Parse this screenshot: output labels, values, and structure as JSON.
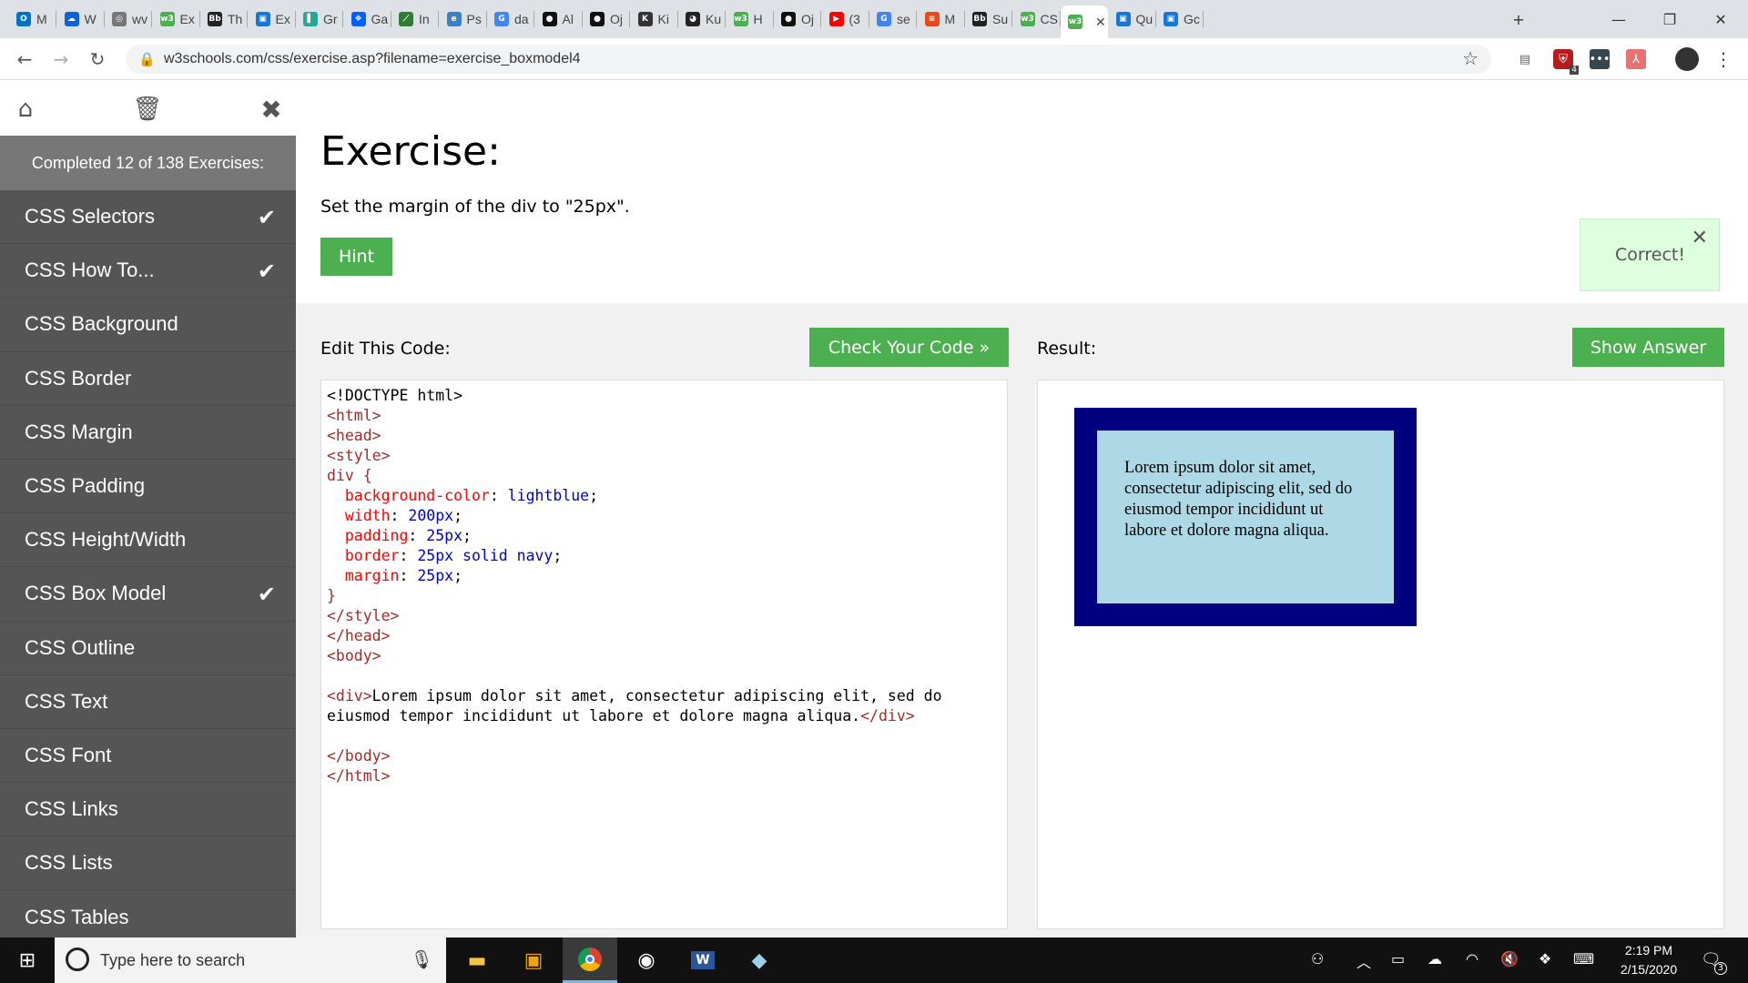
{
  "browser": {
    "tabs": [
      {
        "label": "M",
        "fav": "outlook",
        "color": "#0072c6"
      },
      {
        "label": "W",
        "fav": "onedrive",
        "color": "#0a64d6"
      },
      {
        "label": "wv",
        "fav": "globe",
        "color": "#777"
      },
      {
        "label": "Ex",
        "fav": "w3",
        "color": "#4caf50"
      },
      {
        "label": "Th",
        "fav": "bb",
        "color": "#222"
      },
      {
        "label": "Ex",
        "fav": "ext",
        "color": "#1976d2"
      },
      {
        "label": "Gr",
        "fav": "bar",
        "color": "#26a69a"
      },
      {
        "label": "Ga",
        "fav": "dropbox",
        "color": "#0061fe"
      },
      {
        "label": "In",
        "fav": "leaf",
        "color": "#2e7d32"
      },
      {
        "label": "Ps",
        "fav": "edge",
        "color": "#3b82c4"
      },
      {
        "label": "da",
        "fav": "google",
        "color": "#4285f4"
      },
      {
        "label": "Al",
        "fav": "github",
        "color": "#111"
      },
      {
        "label": "Oj",
        "fav": "github",
        "color": "#111"
      },
      {
        "label": "Ki",
        "fav": "k",
        "color": "#333"
      },
      {
        "label": "Ku",
        "fav": "kuma",
        "color": "#222"
      },
      {
        "label": "H",
        "fav": "w3",
        "color": "#4caf50"
      },
      {
        "label": "Oj",
        "fav": "github",
        "color": "#111"
      },
      {
        "label": "(3",
        "fav": "youtube",
        "color": "#ff0000"
      },
      {
        "label": "se",
        "fav": "google",
        "color": "#4285f4"
      },
      {
        "label": "M",
        "fav": "stripe",
        "color": "#e64a19"
      },
      {
        "label": "Su",
        "fav": "bb",
        "color": "#222"
      },
      {
        "label": "CS",
        "fav": "w3",
        "color": "#4caf50"
      },
      {
        "label": "",
        "fav": "w3",
        "color": "#4caf50",
        "active": true
      },
      {
        "label": "Qu",
        "fav": "ext",
        "color": "#1976d2"
      },
      {
        "label": "Gc",
        "fav": "ext",
        "color": "#1976d2"
      }
    ],
    "url": "w3schools.com/css/exercise.asp?filename=exercise_boxmodel4",
    "ext_badge": "4"
  },
  "sidebar": {
    "progress": "Completed 12 of 138 Exercises:",
    "items": [
      {
        "label": "CSS Selectors",
        "done": true
      },
      {
        "label": "CSS How To...",
        "done": true
      },
      {
        "label": "CSS Background",
        "done": false
      },
      {
        "label": "CSS Border",
        "done": false
      },
      {
        "label": "CSS Margin",
        "done": false
      },
      {
        "label": "CSS Padding",
        "done": false
      },
      {
        "label": "CSS Height/Width",
        "done": false
      },
      {
        "label": "CSS Box Model",
        "done": true
      },
      {
        "label": "CSS Outline",
        "done": false
      },
      {
        "label": "CSS Text",
        "done": false
      },
      {
        "label": "CSS Font",
        "done": false
      },
      {
        "label": "CSS Links",
        "done": false
      },
      {
        "label": "CSS Lists",
        "done": false
      },
      {
        "label": "CSS Tables",
        "done": false
      }
    ]
  },
  "exercise": {
    "title": "Exercise:",
    "instruction": "Set the margin of the div to \"25px\".",
    "hint_label": "Hint",
    "correct_label": "Correct!",
    "edit_label": "Edit This Code:",
    "check_label": "Check Your Code »",
    "result_label": "Result:",
    "answer_label": "Show Answer"
  },
  "code": [
    [
      [
        "tx",
        "<!DOCTYPE html>"
      ]
    ],
    [
      [
        "tg",
        "<html>"
      ]
    ],
    [
      [
        "tg",
        "<head>"
      ]
    ],
    [
      [
        "tg",
        "<style>"
      ]
    ],
    [
      [
        "tg",
        "div {"
      ]
    ],
    [
      [
        "tx",
        "  "
      ],
      [
        "pr",
        "background-color"
      ],
      [
        "tx",
        ": "
      ],
      [
        "vl",
        "lightblue"
      ],
      [
        "tx",
        ";"
      ]
    ],
    [
      [
        "tx",
        "  "
      ],
      [
        "pr",
        "width"
      ],
      [
        "tx",
        ": "
      ],
      [
        "vl",
        "200px"
      ],
      [
        "tx",
        ";"
      ]
    ],
    [
      [
        "tx",
        "  "
      ],
      [
        "pr",
        "padding"
      ],
      [
        "tx",
        ": "
      ],
      [
        "vl",
        "25px"
      ],
      [
        "tx",
        ";"
      ]
    ],
    [
      [
        "tx",
        "  "
      ],
      [
        "pr",
        "border"
      ],
      [
        "tx",
        ": "
      ],
      [
        "vl",
        "25px solid navy"
      ],
      [
        "tx",
        ";"
      ]
    ],
    [
      [
        "tx",
        "  "
      ],
      [
        "pr",
        "margin"
      ],
      [
        "tx",
        ": "
      ],
      [
        "vl",
        "25px"
      ],
      [
        "tx",
        ";"
      ]
    ],
    [
      [
        "tg",
        "}"
      ]
    ],
    [
      [
        "tg",
        "</style>"
      ]
    ],
    [
      [
        "tg",
        "</head>"
      ]
    ],
    [
      [
        "tg",
        "<body>"
      ]
    ],
    [
      [
        "tx",
        ""
      ]
    ],
    [
      [
        "tg",
        "<div>"
      ],
      [
        "tx",
        "Lorem ipsum dolor sit amet, consectetur adipiscing elit, sed do"
      ]
    ],
    [
      [
        "tx",
        "eiusmod tempor incididunt ut labore et dolore magna aliqua."
      ],
      [
        "tg",
        "</div>"
      ]
    ],
    [
      [
        "tx",
        ""
      ]
    ],
    [
      [
        "tg",
        "</body>"
      ]
    ],
    [
      [
        "tg",
        "</html>"
      ]
    ]
  ],
  "result_text": "Lorem ipsum dolor sit amet, consectetur adipiscing elit, sed do eiusmod tempor incididunt ut labore et dolore magna aliqua.",
  "taskbar": {
    "search_placeholder": "Type here to search",
    "time": "2:19 PM",
    "date": "2/15/2020",
    "notif_count": "3"
  }
}
